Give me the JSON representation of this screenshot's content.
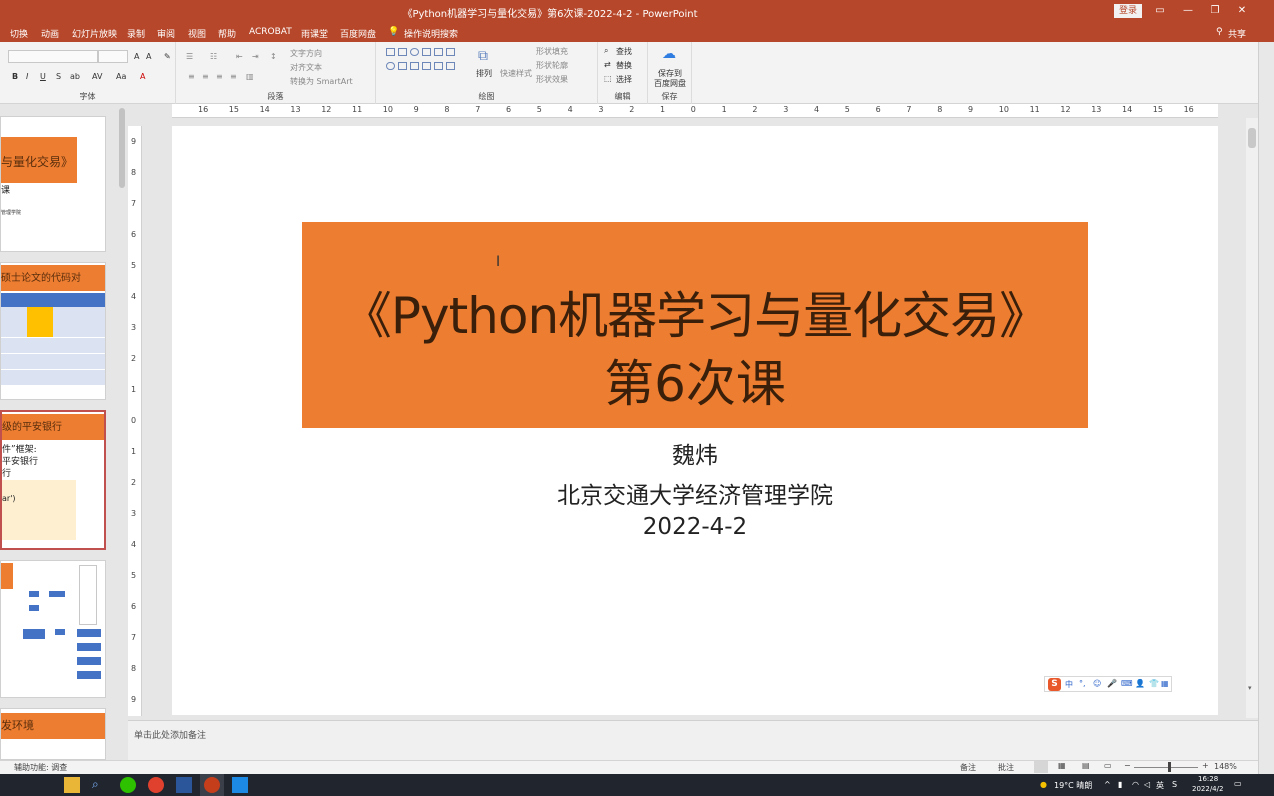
{
  "window": {
    "title": "《Python机器学习与量化交易》第6次课-2022-4-2  -  PowerPoint",
    "login_label": "登录",
    "share_label": "共享"
  },
  "tabs": [
    "切换",
    "动画",
    "幻灯片放映",
    "录制",
    "审阅",
    "视图",
    "帮助",
    "ACROBAT",
    "雨课堂",
    "百度网盘"
  ],
  "tell_me": "操作说明搜索",
  "ribbon": {
    "group_labels": {
      "font": "字体",
      "paragraph": "段落",
      "drawing": "绘图",
      "editing": "编辑",
      "save": "保存"
    },
    "text_direction": "文字方向",
    "align_text": "对齐文本",
    "convert_smartart": "转换为 SmartArt",
    "arrange": "排列",
    "quick_styles": "快速样式",
    "shape_fill": "形状填充",
    "shape_outline": "形状轮廓",
    "shape_effects": "形状效果",
    "find": "查找",
    "replace": "替换",
    "select": "选择",
    "save_to_baidu_l1": "保存到",
    "save_to_baidu_l2": "百度网盘"
  },
  "thumbnails": [
    {
      "title": "与量化交易》",
      "sub": "课",
      "note": "管理学院"
    },
    {
      "title": "硕士论文的代码对"
    },
    {
      "title": "级的平安银行",
      "lines": [
        "件”框架:",
        "平安银行",
        "行",
        "ar')"
      ]
    },
    {
      "title": ""
    },
    {
      "title": "发环境"
    }
  ],
  "ruler_h": [
    "16",
    "15",
    "14",
    "13",
    "12",
    "11",
    "10",
    "9",
    "8",
    "7",
    "6",
    "5",
    "4",
    "3",
    "2",
    "1",
    "0",
    "1",
    "2",
    "3",
    "4",
    "5",
    "6",
    "7",
    "8",
    "9",
    "10",
    "11",
    "12",
    "13",
    "14",
    "15",
    "16"
  ],
  "ruler_v": [
    "9",
    "8",
    "7",
    "6",
    "5",
    "4",
    "3",
    "2",
    "1",
    "0",
    "1",
    "2",
    "3",
    "4",
    "5",
    "6",
    "7",
    "8",
    "9"
  ],
  "slide": {
    "title_line1": "《Python机器学习与量化交易》",
    "title_line2": "第6次课",
    "author": "魏炜",
    "affiliation": "北京交通大学经济管理学院",
    "date": "2022-4-2",
    "banner_color": "#ed7d31"
  },
  "ime_bar": {
    "label": "中"
  },
  "notes_placeholder": "单击此处添加备注",
  "status": {
    "accessibility": "辅助功能: 调查",
    "notes_btn": "备注",
    "comments_btn": "批注",
    "zoom": "148%"
  },
  "taskbar": {
    "weather": "19°C 晴朗",
    "ime": "英",
    "time": "16:28",
    "date": "2022/4/2"
  }
}
